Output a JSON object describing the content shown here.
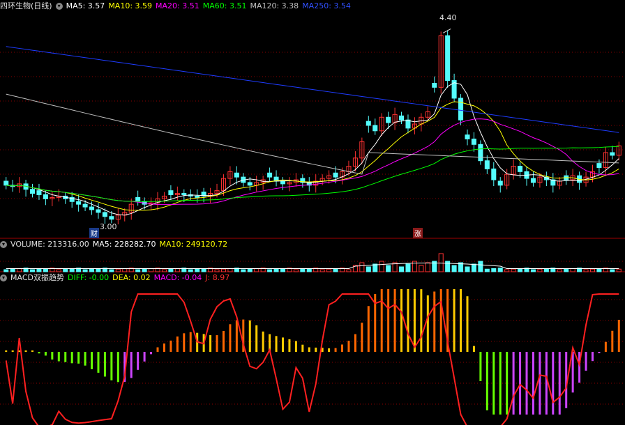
{
  "main": {
    "title": "四环生物(日线)",
    "ma5": "MA5: 3.57",
    "ma10": "MA10: 3.59",
    "ma20": "MA20: 3.51",
    "ma60": "MA60: 3.51",
    "ma120": "MA120: 3.38",
    "ma250": "MA250: 3.54",
    "high_label": "4.40",
    "low_label": "3.00",
    "tag_cai": "财",
    "tag_zhang": "涨",
    "price_range": [
      2.9,
      4.55
    ]
  },
  "volume": {
    "title": "VOLUME: 213316.00",
    "ma5": "MA5: 228282.70",
    "ma10": "MA10: 249120.72"
  },
  "macd": {
    "title": "MACD双振趋势",
    "diff": "DIFF: -0.00",
    "dea": "DEA: 0.02",
    "macd": "MACD: -0.04",
    "j": "J: 8.97"
  },
  "colors": {
    "up": "#ff3232",
    "down": "#54fcfc",
    "ma5": "#ffffff",
    "ma10": "#ffff00",
    "ma20": "#ff00ff",
    "ma60": "#00ff00",
    "ma120": "#c0c0c0",
    "ma250": "#1e3cff",
    "grid": "#8b0000",
    "j_line": "#ff2020",
    "macd_orange": "#ff6600",
    "macd_yellow": "#ffcc00",
    "macd_green": "#66ff00",
    "macd_purple": "#cc44ff"
  },
  "chart_data": {
    "type": "candlestick",
    "closes": [
      3.28,
      3.27,
      3.29,
      3.25,
      3.22,
      3.21,
      3.18,
      3.19,
      3.2,
      3.18,
      3.16,
      3.14,
      3.12,
      3.1,
      3.08,
      3.05,
      3.03,
      3.06,
      3.08,
      3.14,
      3.16,
      3.14,
      3.15,
      3.18,
      3.2,
      3.21,
      3.22,
      3.21,
      3.2,
      3.19,
      3.2,
      3.22,
      3.24,
      3.33,
      3.38,
      3.34,
      3.3,
      3.28,
      3.3,
      3.32,
      3.34,
      3.31,
      3.29,
      3.3,
      3.32,
      3.3,
      3.28,
      3.31,
      3.33,
      3.35,
      3.34,
      3.38,
      3.42,
      3.48,
      3.6,
      3.72,
      3.68,
      3.78,
      3.74,
      3.8,
      3.76,
      3.7,
      3.73,
      3.78,
      3.82,
      4.0,
      4.38,
      4.05,
      3.92,
      3.76,
      3.62,
      3.58,
      3.46,
      3.4,
      3.32,
      3.28,
      3.36,
      3.42,
      3.38,
      3.33,
      3.3,
      3.34,
      3.32,
      3.28,
      3.31,
      3.32,
      3.35,
      3.3,
      3.34,
      3.38,
      3.41,
      3.52,
      3.5,
      3.57
    ]
  }
}
